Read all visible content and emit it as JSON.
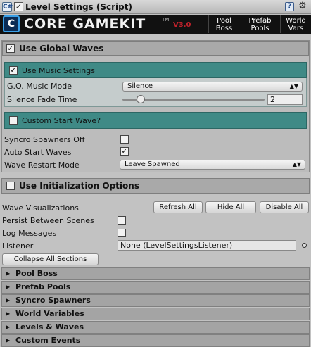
{
  "header": {
    "title": "Level Settings (Script)",
    "component_icon": "C#",
    "help_icon": "?",
    "gear_icon": "⚙"
  },
  "banner": {
    "logo_letter": "C",
    "logo_text": "CORE GAMEKIT",
    "tm": "TM",
    "version": "V3.0",
    "nav": [
      {
        "line1": "Pool",
        "line2": "Boss"
      },
      {
        "line1": "Prefab",
        "line2": "Pools"
      },
      {
        "line1": "World",
        "line2": "Vars"
      }
    ]
  },
  "global_waves": {
    "label": "Use Global Waves",
    "music": {
      "label": "Use Music Settings",
      "go_music_mode_label": "G.O. Music Mode",
      "go_music_mode_value": "Silence",
      "fade_label": "Silence Fade Time",
      "fade_value": "2",
      "fade_fraction": 0.13
    },
    "custom_start_label": "Custom Start Wave?",
    "syncro_label": "Syncro Spawners Off",
    "auto_start_label": "Auto Start Waves",
    "restart_label": "Wave Restart Mode",
    "restart_value": "Leave Spawned"
  },
  "init_options": {
    "label": "Use Initialization Options"
  },
  "settings": {
    "wave_vis_label": "Wave Visualizations",
    "refresh_all": "Refresh All",
    "hide_all": "Hide All",
    "disable_all": "Disable All",
    "persist_label": "Persist Between Scenes",
    "log_label": "Log Messages",
    "listener_label": "Listener",
    "listener_value": "None (LevelSettingsListener)",
    "collapse_all": "Collapse All Sections"
  },
  "sections": [
    "Pool Boss",
    "Prefab Pools",
    "Syncro Spawners",
    "World Variables",
    "Levels & Waves",
    "Custom Events"
  ],
  "check_mark": "✓"
}
